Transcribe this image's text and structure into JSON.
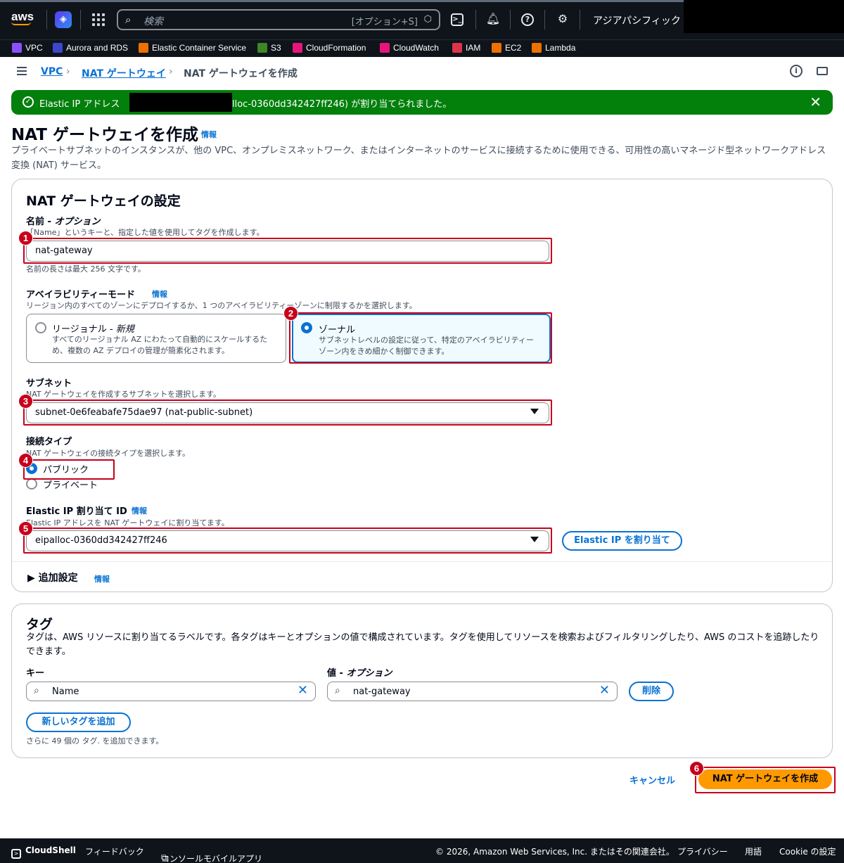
{
  "topnav": {
    "logo": "aws",
    "search_placeholder": "検索",
    "search_shortcut": "[オプション+S]",
    "region": "アジアパシフィック (東京)",
    "icons": [
      "q-developer-icon",
      "apps-grid-icon",
      "cloudshell-icon",
      "bell-icon",
      "help-icon",
      "settings-icon"
    ]
  },
  "favorites": [
    {
      "label": "VPC",
      "color": "#8c4fff"
    },
    {
      "label": "Aurora and RDS",
      "color": "#3b48cc"
    },
    {
      "label": "Elastic Container Service",
      "color": "#ed7100"
    },
    {
      "label": "S3",
      "color": "#3f8624"
    },
    {
      "label": "CloudFormation",
      "color": "#e7157b"
    },
    {
      "label": "CloudWatch",
      "color": "#e7157b"
    },
    {
      "label": "IAM",
      "color": "#dd344c"
    },
    {
      "label": "EC2",
      "color": "#ed7100"
    },
    {
      "label": "Lambda",
      "color": "#ed7100"
    }
  ],
  "breadcrumb": {
    "vpc": "VPC",
    "natgw": "NAT ゲートウェイ",
    "current": "NAT ゲートウェイを作成"
  },
  "flash": {
    "prefix": "Elastic IP アドレス",
    "suffix": "lloc-0360dd342427ff246) が割り当てられました。"
  },
  "header": {
    "title": "NAT ゲートウェイを作成",
    "info": "情報",
    "description": "プライベートサブネットのインスタンスが、他の VPC、オンプレミスネットワーク、またはインターネットのサービスに接続するために使用できる、可用性の高いマネージド型ネットワークアドレス変換 (NAT) サービス。"
  },
  "settings": {
    "title": "NAT ゲートウェイの設定",
    "name_label": "名前 - ",
    "name_optional": "オプション",
    "name_desc": "「Name」というキーと、指定した値を使用してタグを作成します。",
    "name_value": "nat-gateway",
    "name_constraint": "名前の長さは最大 256 文字です。",
    "availability_label": "アベイラビリティーモード",
    "availability_info": "情報",
    "availability_desc": "リージョン内のすべてのゾーンにデプロイするか、1 つのアベイラビリティーゾーンに制限するかを選択します。",
    "regional_title": "リージョナル - ",
    "regional_new": "新規",
    "regional_desc": "すべてのリージョナル AZ にわたって自動的にスケールするため、複数の AZ デプロイの管理が簡素化されます。",
    "zonal_title": "ゾーナル",
    "zonal_desc": "サブネットレベルの設定に従って、特定のアベイラビリティーゾーン内をきめ細かく制御できます。",
    "subnet_label": "サブネット",
    "subnet_desc": "NAT ゲートウェイを作成するサブネットを選択します。",
    "subnet_value": "subnet-0e6feabafe75dae97 (nat-public-subnet)",
    "conn_label": "接続タイプ",
    "conn_desc": "NAT ゲートウェイの接続タイプを選択します。",
    "conn_public": "パブリック",
    "conn_private": "プライベート",
    "eip_label": "Elastic IP 割り当て ID",
    "eip_info": "情報",
    "eip_desc": "Elastic IP アドレスを NAT ゲートウェイに割り当てます。",
    "eip_value": "eipalloc-0360dd342427ff246",
    "eip_button": "Elastic IP を割り当て",
    "additional": "追加設定",
    "additional_info": "情報"
  },
  "tags": {
    "title": "タグ",
    "desc": "タグは、AWS リソースに割り当てるラベルです。各タグはキーとオプションの値で構成されています。タグを使用してリソースを検索およびフィルタリングしたり、AWS のコストを追跡したりできます。",
    "key_label": "キー",
    "value_label": "値 - ",
    "value_optional": "オプション",
    "key_value": "Name",
    "value_value": "nat-gateway",
    "remove": "削除",
    "add": "新しいタグを追加",
    "remaining": "さらに 49 個の タグ. を追加できます。"
  },
  "actions": {
    "cancel": "キャンセル",
    "create": "NAT ゲートウェイを作成"
  },
  "annotations": [
    "1",
    "2",
    "3",
    "4",
    "5",
    "6"
  ],
  "footer": {
    "cloudshell": "CloudShell",
    "feedback": "フィードバック",
    "mobile": "コンソールモバイルアプリ",
    "copyright": "© 2026, Amazon Web Services, Inc. またはその関連会社。",
    "privacy": "プライバシー",
    "terms": "用語",
    "cookie": "Cookie の設定"
  },
  "colors": {
    "accent": "#0972d3",
    "success": "#037f0c",
    "primary": "#ff9900",
    "annotation": "#c7001b",
    "nav": "#0f141a"
  }
}
